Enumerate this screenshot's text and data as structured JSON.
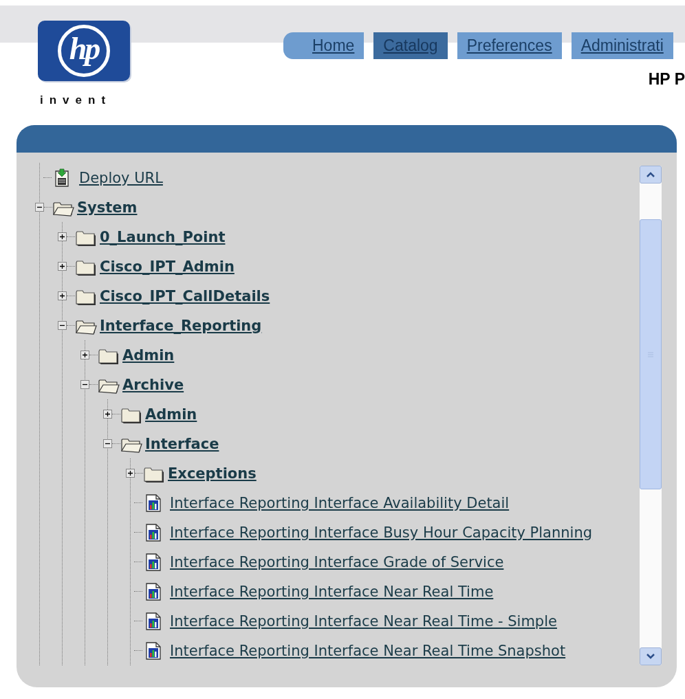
{
  "logo": {
    "mark": "hp",
    "tagline": "invent"
  },
  "tabs": [
    {
      "label": "Home",
      "selected": false
    },
    {
      "label": "Catalog",
      "selected": true
    },
    {
      "label": "Preferences",
      "selected": false
    },
    {
      "label": "Administrati",
      "selected": false
    }
  ],
  "page_title": "HP P",
  "tree": [
    {
      "kind": "deploy",
      "label": "Deploy URL"
    },
    {
      "kind": "folder",
      "label": "System",
      "expanded": true,
      "children": [
        {
          "kind": "folder",
          "label": "0_Launch_Point",
          "expanded": false
        },
        {
          "kind": "folder",
          "label": "Cisco_IPT_Admin",
          "expanded": false
        },
        {
          "kind": "folder",
          "label": "Cisco_IPT_CallDetails",
          "expanded": false
        },
        {
          "kind": "folder",
          "label": "Interface_Reporting",
          "expanded": true,
          "children": [
            {
              "kind": "folder",
              "label": "Admin",
              "expanded": false
            },
            {
              "kind": "folder",
              "label": "Archive",
              "expanded": true,
              "children": [
                {
                  "kind": "folder",
                  "label": "Admin",
                  "expanded": false
                },
                {
                  "kind": "folder",
                  "label": "Interface",
                  "expanded": true,
                  "children": [
                    {
                      "kind": "folder",
                      "label": "Exceptions",
                      "expanded": false
                    },
                    {
                      "kind": "report",
                      "label": "Interface Reporting Interface Availability Detail"
                    },
                    {
                      "kind": "report",
                      "label": "Interface Reporting Interface Busy Hour Capacity Planning"
                    },
                    {
                      "kind": "report",
                      "label": "Interface Reporting Interface Grade of Service"
                    },
                    {
                      "kind": "report",
                      "label": "Interface Reporting Interface Near Real Time"
                    },
                    {
                      "kind": "report",
                      "label": "Interface Reporting Interface Near Real Time - Simple"
                    },
                    {
                      "kind": "report",
                      "label": "Interface Reporting Interface Near Real Time Snapshot"
                    }
                  ]
                }
              ]
            }
          ]
        }
      ]
    }
  ]
}
